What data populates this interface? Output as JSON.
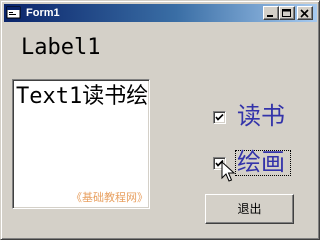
{
  "window": {
    "title": "Form1",
    "title_color": "#ffffff",
    "titlebar_colors": [
      "#0a246a",
      "#a6caf0"
    ],
    "caption_buttons": {
      "minimize_icon": "minimize-icon",
      "maximize_icon": "maximize-icon",
      "close_icon": "close-icon"
    }
  },
  "form": {
    "label1": "Label1",
    "text1_value": "Text1读书绘",
    "watermark": "《基础教程网》",
    "checkboxes": [
      {
        "label": "读书",
        "checked": true,
        "focused": false
      },
      {
        "label": "绘画",
        "checked": true,
        "focused": true
      }
    ],
    "exit_button": "退出"
  },
  "colors": {
    "form_bg": "#d4d0c8",
    "checkbox_label": "#3333aa",
    "watermark": "#e8a060"
  }
}
